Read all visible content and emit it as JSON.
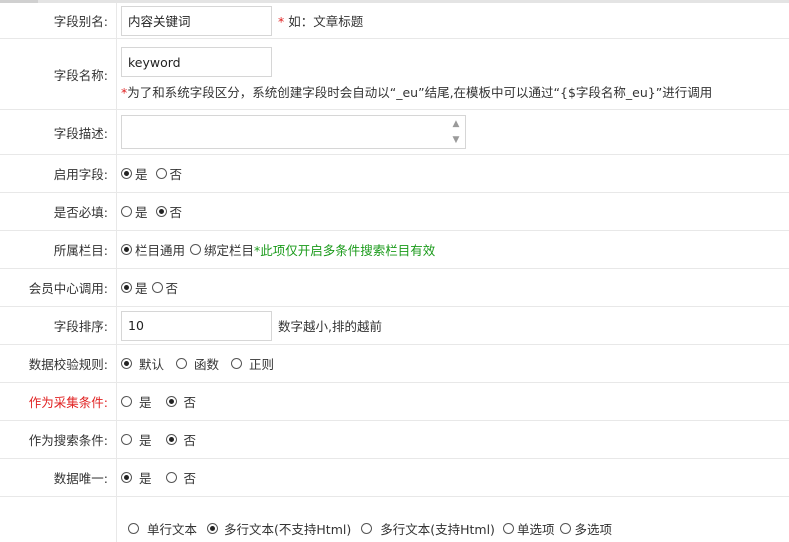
{
  "fields": {
    "alias": {
      "label": "字段别名:",
      "value": "内容关键词",
      "hint_star": "*",
      "hint": "如：文章标题"
    },
    "name": {
      "label": "字段名称:",
      "value": "keyword",
      "note_star": "*",
      "note": "为了和系统字段区分，系统创建字段时会自动以“_eu”结尾,在模板中可以通过“{$字段名称_eu}”进行调用"
    },
    "desc": {
      "label": "字段描述:",
      "value": ""
    },
    "enabled": {
      "label": "启用字段:",
      "options": [
        "是",
        "否"
      ],
      "selected": 0
    },
    "required": {
      "label": "是否必填:",
      "options": [
        "是",
        "否"
      ],
      "selected": 1
    },
    "column": {
      "label": "所属栏目:",
      "options": [
        "栏目通用",
        "绑定栏目"
      ],
      "selected": 0,
      "note": "*此项仅开启多条件搜索栏目有效"
    },
    "member": {
      "label": "会员中心调用:",
      "options": [
        "是",
        "否"
      ],
      "selected": 0
    },
    "sort": {
      "label": "字段排序:",
      "value": "10",
      "hint": "数字越小,排的越前"
    },
    "validate": {
      "label": "数据校验规则:",
      "options": [
        "默认",
        "函数",
        "正则"
      ],
      "selected": 0
    },
    "collect": {
      "label": "作为采集条件:",
      "options": [
        "是",
        "否"
      ],
      "selected": 1
    },
    "search": {
      "label": "作为搜索条件:",
      "options": [
        "是",
        "否"
      ],
      "selected": 1
    },
    "unique": {
      "label": "数据唯一:",
      "options": [
        "是",
        "否"
      ],
      "selected": 0
    },
    "type": {
      "label": "",
      "options": [
        "单行文本",
        "多行文本(不支持Html)",
        "多行文本(支持Html)",
        "单选项",
        "多选项"
      ],
      "selected": 1
    }
  },
  "colors": {
    "required_red": "#e02222",
    "note_green": "#1a9a1a",
    "border": "#e8e8e8"
  }
}
